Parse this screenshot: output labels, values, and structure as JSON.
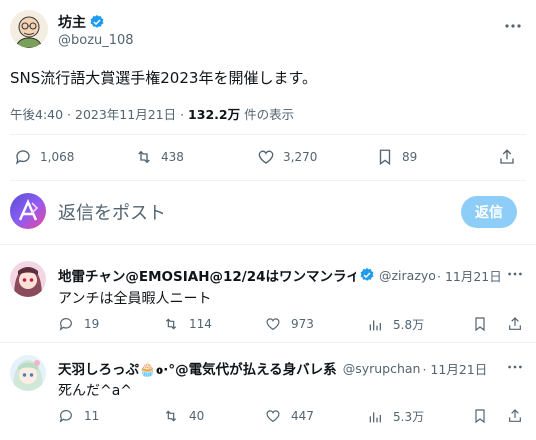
{
  "colors": {
    "accent": "#1d9bf0",
    "verified": "#1d9bf0",
    "text": "#0f1419",
    "muted": "#536471",
    "reply_button_bg": "#8ecdf8"
  },
  "post": {
    "author_name": "坊主",
    "author_handle": "@bozu_108",
    "text": "SNS流行語大賞選手権2023年を開催します。",
    "time": "午後4:40 · 2023年11月21日 · ",
    "views_count": "132.2万",
    "views_label": " 件の表示",
    "stats": {
      "replies": "1,068",
      "reposts": "438",
      "likes": "3,270",
      "bookmarks": "89"
    }
  },
  "composer": {
    "placeholder": "返信をポスト",
    "button_label": "返信"
  },
  "replies": [
    {
      "author_name": "地雷チャン@EMOSIAH@12/24はワンマンライブ",
      "author_handle": "@zirazyo_",
      "date": "· 11月21日",
      "text": "アンチは全員暇人ニート",
      "stats": {
        "replies": "19",
        "reposts": "114",
        "likes": "973",
        "views": "5.8万"
      }
    },
    {
      "author_name": "天羽しろっぷ🧁ߋ·°@電気代が払える身バレ系",
      "author_handle": "@syrupchan",
      "date": "· 11月21日",
      "text": "死んだ^a^",
      "stats": {
        "replies": "11",
        "reposts": "40",
        "likes": "447",
        "views": "5.3万"
      }
    }
  ]
}
